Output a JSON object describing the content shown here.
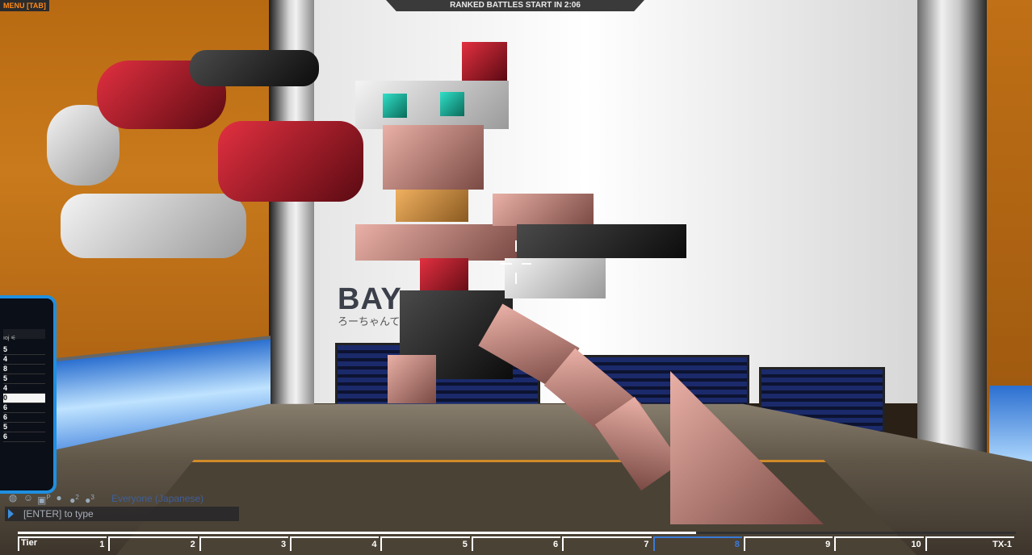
{
  "hud": {
    "menu_label": "MENU [TAB]",
    "battle_banner": "RANKED BATTLES START IN 2:06"
  },
  "scene": {
    "bay_logo": "BAY",
    "bay_subtitle": "ろーちゃんて"
  },
  "side_panel": {
    "header": "ıoj ⚟",
    "rows": [
      "5",
      "4",
      "8",
      "5",
      "4",
      "0",
      "6",
      "6",
      "5",
      "6"
    ],
    "selected_index": 5
  },
  "chat": {
    "icons": [
      "globe-icon",
      "person-icon",
      "party-icon",
      "user-icon",
      "users-2-icon",
      "users-3-icon"
    ],
    "icon_badges": [
      "",
      "",
      "P",
      "",
      "2",
      "3"
    ],
    "channel": "Everyone (Japanese)",
    "placeholder": "[ENTER] to type"
  },
  "tier_bar": {
    "first_label": "Tier",
    "labels": [
      "1",
      "2",
      "3",
      "4",
      "5",
      "6",
      "7",
      "8",
      "9",
      "10",
      "TX-1"
    ],
    "current_index": 7,
    "progress": 0.68
  },
  "colors": {
    "accent_orange": "#ff8a1c",
    "accent_blue": "#1f8fe0",
    "current_tier": "#3a7ad8"
  }
}
